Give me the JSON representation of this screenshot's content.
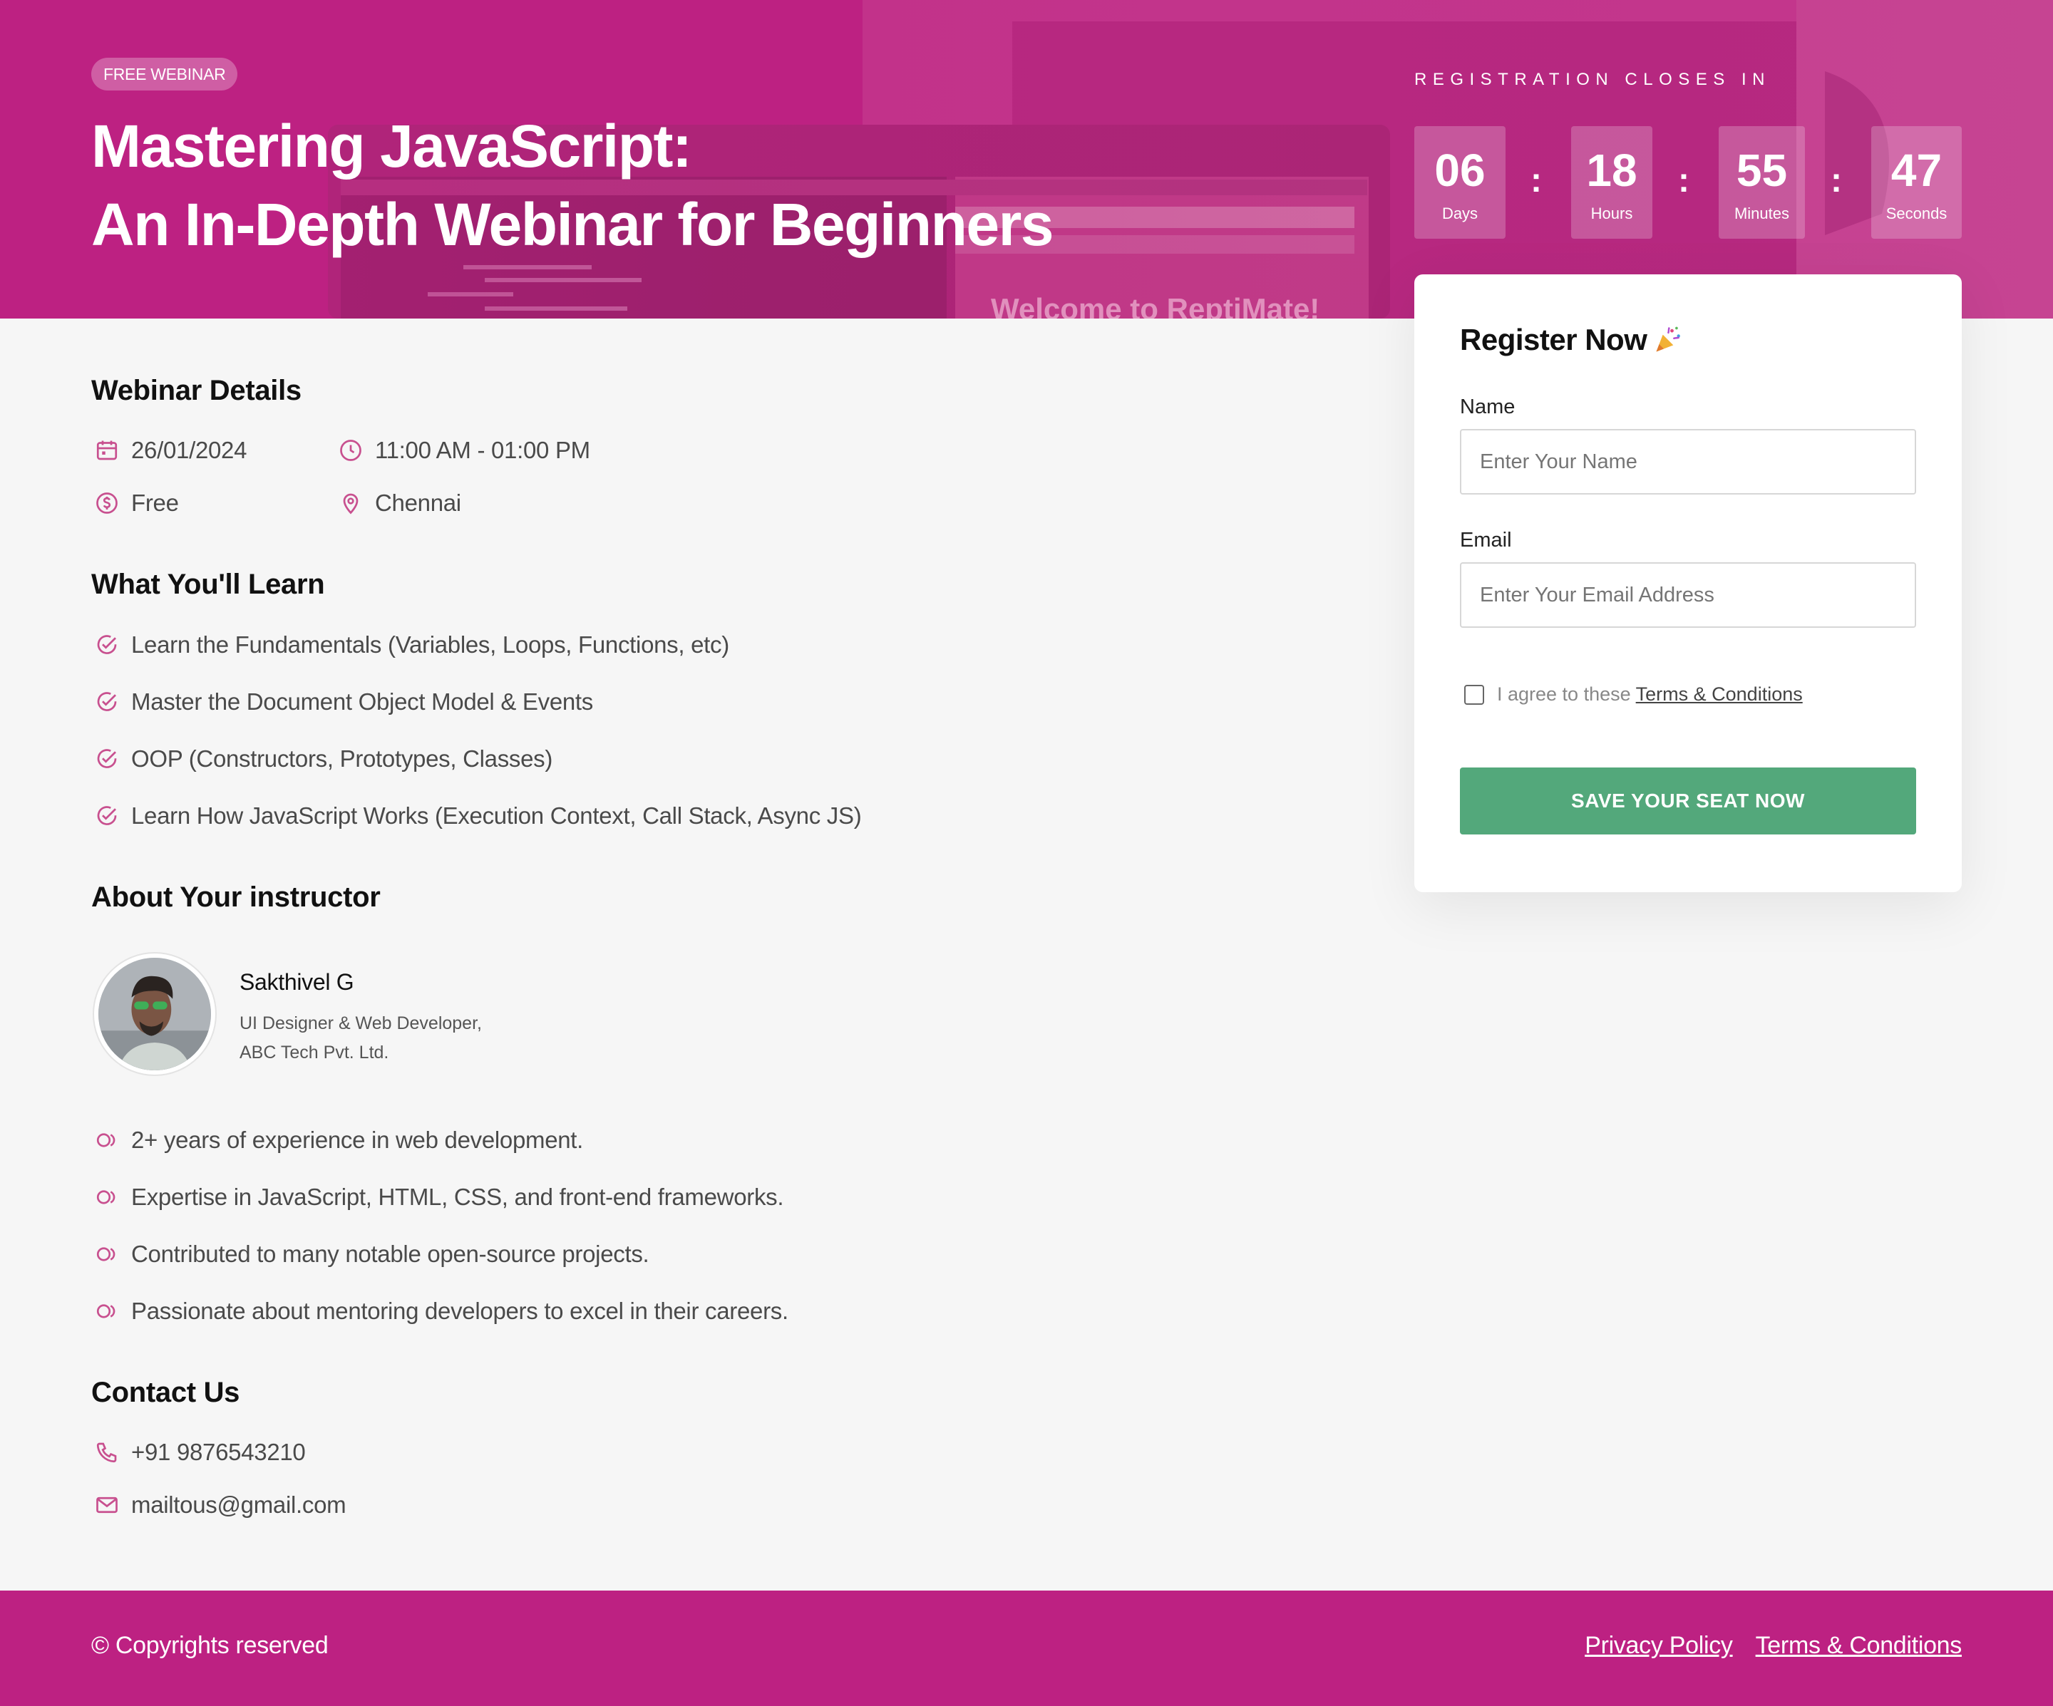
{
  "hero": {
    "badge": "FREE WEBINAR",
    "title_line1": "Mastering JavaScript:",
    "title_line2": "An In-Depth Webinar for Beginners",
    "background_text": "Welcome to ReptiMate!",
    "countdown_label": "REGISTRATION CLOSES IN",
    "countdown": [
      {
        "value": "06",
        "unit": "Days"
      },
      {
        "value": "18",
        "unit": "Hours"
      },
      {
        "value": "55",
        "unit": "Minutes"
      },
      {
        "value": "47",
        "unit": "Seconds"
      }
    ],
    "separator": ":"
  },
  "details": {
    "title": "Webinar Details",
    "date": "26/01/2024",
    "time": "11:00 AM - 01:00 PM",
    "price": "Free",
    "location": "Chennai"
  },
  "learn": {
    "title": "What You'll Learn",
    "items": [
      "Learn the Fundamentals (Variables, Loops, Functions, etc)",
      "Master the Document Object Model & Events",
      "OOP (Constructors, Prototypes, Classes)",
      "Learn How JavaScript Works (Execution Context, Call Stack, Async JS)"
    ]
  },
  "instructor": {
    "title": "About Your instructor",
    "name": "Sakthivel G",
    "role_line1": "UI Designer & Web Developer,",
    "role_line2": "ABC Tech Pvt. Ltd.",
    "points": [
      "2+ years of experience in web development.",
      "Expertise in JavaScript, HTML, CSS, and front-end frameworks.",
      "Contributed to many notable open-source projects.",
      "Passionate about mentoring developers to excel in their careers."
    ]
  },
  "contact": {
    "title": "Contact Us",
    "phone": "+91 9876543210",
    "email": "mailtous@gmail.com"
  },
  "form": {
    "title": "Register Now",
    "name_label": "Name",
    "name_placeholder": "Enter Your Name",
    "email_label": "Email",
    "email_placeholder": "Enter Your Email Address",
    "agree_text": "I agree to these",
    "terms_link": "Terms & Conditions",
    "submit": "SAVE YOUR SEAT NOW"
  },
  "footer": {
    "copyright": "© Copyrights reserved",
    "privacy": "Privacy Policy",
    "terms": "Terms & Conditions"
  },
  "colors": {
    "brand": "#bd2182",
    "accent_icon": "#c8508f",
    "button": "#53a87b"
  }
}
